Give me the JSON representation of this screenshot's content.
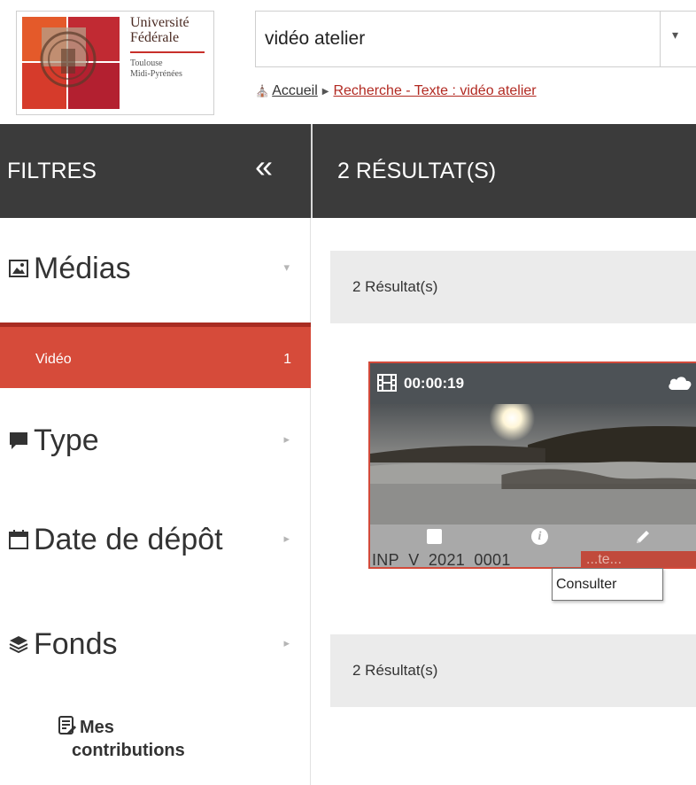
{
  "logo": {
    "line1": "Université",
    "line2": "Fédérale",
    "line3": "Toulouse",
    "line4": "Midi-Pyrénées"
  },
  "search": {
    "value": "vidéo atelier"
  },
  "breadcrumb": {
    "home": "Accueil",
    "current": "Recherche - Texte : vidéo atelier"
  },
  "filters": {
    "title": "FILTRES",
    "facets": [
      {
        "label": "Médias",
        "icon": "image-icon"
      },
      {
        "label": "Type",
        "icon": "comment-icon"
      },
      {
        "label": "Date de dépôt",
        "icon": "calendar-icon"
      },
      {
        "label": "Fonds",
        "icon": "layers-icon"
      }
    ],
    "selected": {
      "label": "Vidéo",
      "count": "1"
    },
    "contributions": {
      "line1": "Mes",
      "line2": "contributions"
    }
  },
  "results": {
    "title": "2 RÉSULTAT(S)",
    "count_label_top": "2 Résultat(s)",
    "count_label_bottom": "2 Résultat(s)"
  },
  "card": {
    "duration": "00:00:19",
    "id": "INP_V_2021_0001",
    "tag": "...te..."
  },
  "tooltip": {
    "text": "Consulter"
  },
  "colors": {
    "accent": "#d64b3a",
    "dark_bar": "#3b3b3b",
    "link": "#b22a22"
  }
}
